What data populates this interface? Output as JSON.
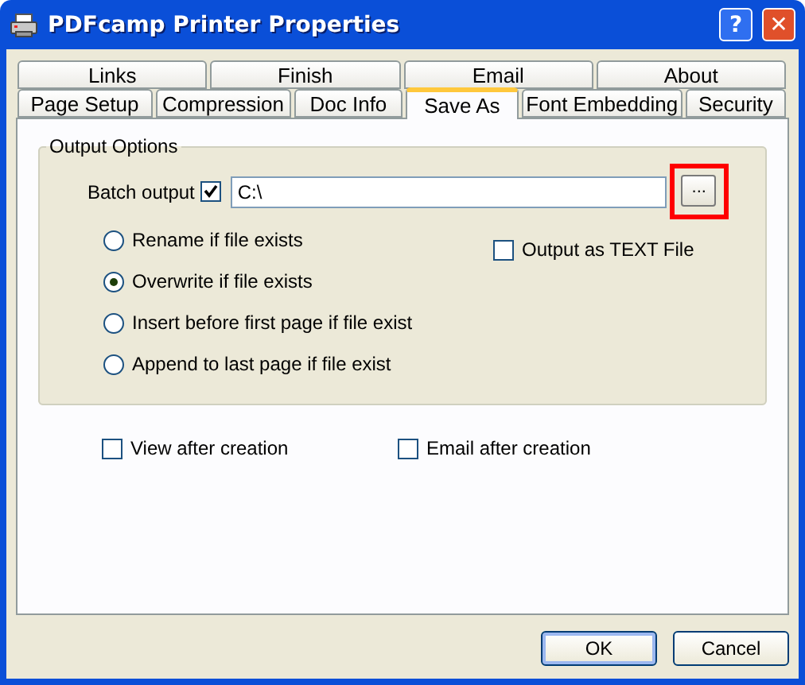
{
  "window": {
    "title": "PDFcamp Printer Properties"
  },
  "title_buttons": [
    {
      "kind": "help",
      "label": "?"
    },
    {
      "kind": "close",
      "label": "✕"
    }
  ],
  "tab_rows": [
    [
      {
        "label": "Links",
        "selected": false
      },
      {
        "label": "Finish",
        "selected": false
      },
      {
        "label": "Email",
        "selected": false
      },
      {
        "label": "About",
        "selected": false
      }
    ],
    [
      {
        "label": "Page Setup",
        "selected": false
      },
      {
        "label": "Compression",
        "selected": false
      },
      {
        "label": "Doc Info",
        "selected": false
      },
      {
        "label": "Save As",
        "selected": true
      },
      {
        "label": "Font Embedding",
        "selected": false
      },
      {
        "label": "Security",
        "selected": false
      }
    ]
  ],
  "output_options": {
    "title": "Output Options",
    "batch_output": {
      "label": "Batch output",
      "checked": true,
      "value": "C:\\",
      "browse_label": "...",
      "browse_highlighted": true
    },
    "radios": [
      {
        "label": "Rename if file exists",
        "selected": false
      },
      {
        "label": "Overwrite if file exists",
        "selected": true
      },
      {
        "label": "Insert before first page if file exist",
        "selected": false
      },
      {
        "label": "Append to last page if file exist",
        "selected": false
      }
    ],
    "text_file": {
      "label": "Output as TEXT File",
      "checked": false
    }
  },
  "after_options": [
    {
      "label": "View after creation",
      "checked": false
    },
    {
      "label": "Email after creation",
      "checked": false
    }
  ],
  "buttons": [
    {
      "label": "OK",
      "default": true
    },
    {
      "label": "Cancel",
      "default": false
    }
  ]
}
